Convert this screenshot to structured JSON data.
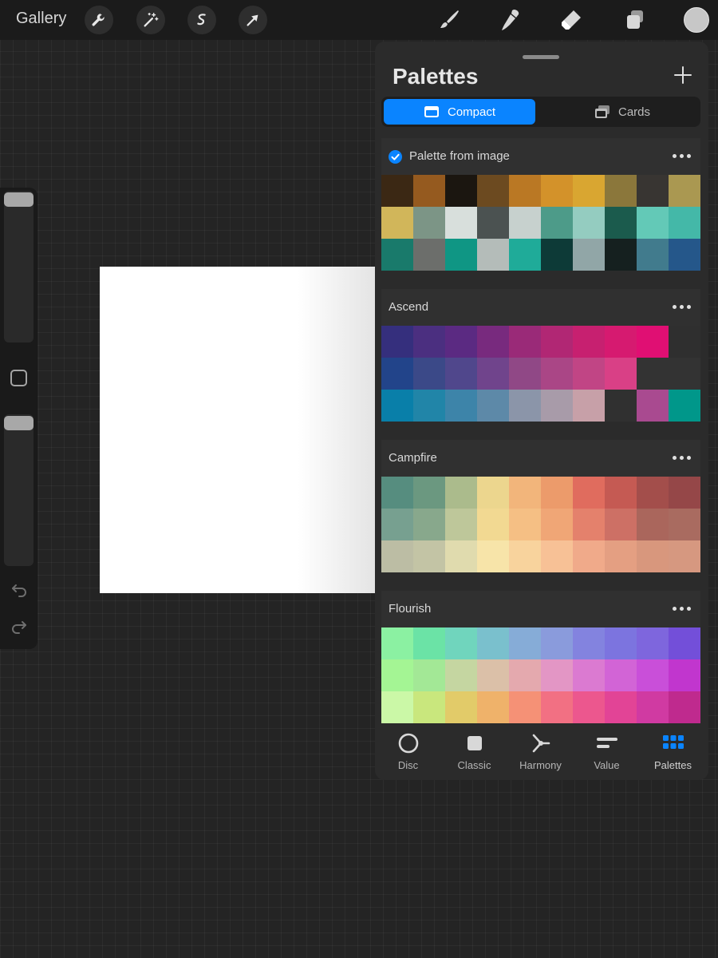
{
  "toolbar": {
    "gallery_label": "Gallery",
    "left_icons": [
      "wrench-icon",
      "magic-wand-icon",
      "selection-icon",
      "transform-arrow-icon"
    ],
    "right_tools": [
      "brush-icon",
      "smudge-icon",
      "eraser-icon",
      "layers-icon"
    ],
    "current_color": "#c7c7c7"
  },
  "panel": {
    "title": "Palettes",
    "segments": {
      "compact_label": "Compact",
      "cards_label": "Cards",
      "selected": "Compact"
    },
    "palettes": [
      {
        "name": "Palette from image",
        "default": true,
        "rows": [
          [
            "#3b2814",
            "#955a1f",
            "#1b1610",
            "#6c4a20",
            "#ba7824",
            "#d3922a",
            "#d9a631",
            "#8b773b",
            "#383532",
            "#aa9851"
          ],
          [
            "#d1b65a",
            "#7c9586",
            "#d8dfdc",
            "#4b5251",
            "#c7d1ce",
            "#4d9b89",
            "#94ccc0",
            "#1b5b4d",
            "#63c9b7",
            "#44b8a8"
          ],
          [
            "#197a6b",
            "#6c6e6b",
            "#0f9684",
            "#b4bcb9",
            "#1fab99",
            "#0d3a37",
            "#91a6a7",
            "#15201f",
            "#417b8d",
            "#25578a"
          ]
        ]
      },
      {
        "name": "Ascend",
        "default": false,
        "rows": [
          [
            "#352f7d",
            "#4b2f80",
            "#5b2a82",
            "#782a7e",
            "#9a2a78",
            "#b12774",
            "#c72070",
            "#d61a70",
            "#e00f73",
            "#2f2f2f"
          ],
          [
            "#22448a",
            "#3b4988",
            "#50478c",
            "#70448c",
            "#904886",
            "#aa4686",
            "#c14585",
            "#d94086",
            "#333333",
            "#333333"
          ],
          [
            "#097fa9",
            "#2185a8",
            "#3d84a9",
            "#5d89a8",
            "#8b95a9",
            "#a89ba9",
            "#c7a0a8",
            "#303030",
            "#a94a90",
            "#00978a"
          ]
        ]
      },
      {
        "name": "Campfire",
        "default": false,
        "rows": [
          [
            "#568d7f",
            "#6b9880",
            "#abbb8c",
            "#ecd68e",
            "#f2b57b",
            "#ec9b6b",
            "#e06c5e",
            "#c55a53",
            "#a34e4b",
            "#954748"
          ],
          [
            "#77a090",
            "#88a88c",
            "#bec79a",
            "#f2d992",
            "#f5bf84",
            "#f0a676",
            "#e4816c",
            "#cd7065",
            "#aa665c",
            "#a96b60"
          ],
          [
            "#bcbda4",
            "#c3c4a5",
            "#e0dbae",
            "#f7e4a9",
            "#f8d39d",
            "#f7c196",
            "#f0aa8a",
            "#e49f82",
            "#d8977d",
            "#d69880"
          ]
        ]
      },
      {
        "name": "Flourish",
        "default": false,
        "rows": [
          [
            "#8bf1a2",
            "#6be3a6",
            "#70d5bd",
            "#7ac0cd",
            "#86acd7",
            "#8a9bdc",
            "#8383df",
            "#7c74df",
            "#7e66dd",
            "#734fd9"
          ],
          [
            "#a4f594",
            "#a3e896",
            "#c5d6a1",
            "#dbc0a8",
            "#e4a9ae",
            "#e396c5",
            "#db7ad1",
            "#d264d6",
            "#c94fd9",
            "#c136ce"
          ],
          [
            "#cbf8a7",
            "#c9e77d",
            "#e2cb69",
            "#efb26a",
            "#f59176",
            "#f27083",
            "#ec578e",
            "#e24496",
            "#d03aa2",
            "#bf2a8e"
          ]
        ]
      }
    ]
  },
  "tabs": [
    {
      "label": "Disc",
      "icon": "disc-icon"
    },
    {
      "label": "Classic",
      "icon": "classic-icon"
    },
    {
      "label": "Harmony",
      "icon": "harmony-icon"
    },
    {
      "label": "Value",
      "icon": "value-icon"
    },
    {
      "label": "Palettes",
      "icon": "palettes-icon",
      "active": true
    }
  ],
  "colors": {
    "accent": "#0a84ff",
    "panel_bg": "#2b2b2b",
    "canvas": "#ffffff"
  }
}
